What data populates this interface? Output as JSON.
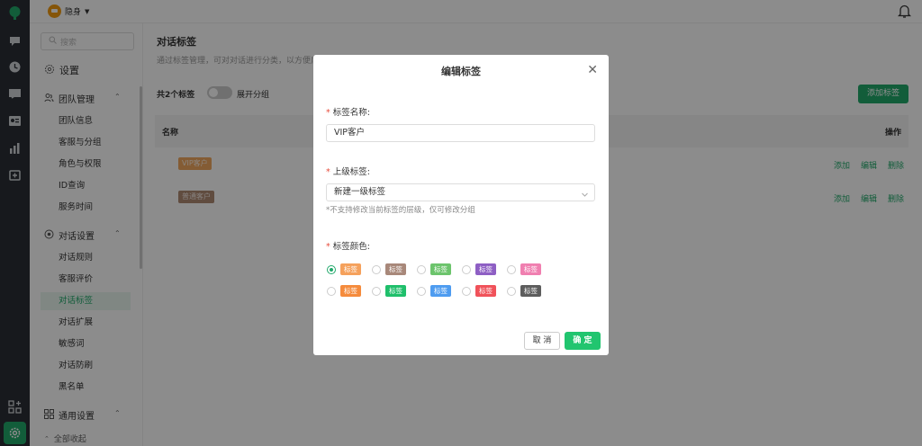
{
  "topbar": {
    "status": "隐身"
  },
  "sidebar": {
    "search_placeholder": "搜索",
    "settings_title": "设置",
    "groups": [
      {
        "label": "团队管理",
        "items": [
          "团队信息",
          "客服与分组",
          "角色与权限",
          "ID查询",
          "服务时间"
        ]
      },
      {
        "label": "对话设置",
        "items": [
          "对话规则",
          "客服评价",
          "对话标签",
          "对话扩展",
          "敏感词",
          "对话防刷",
          "黑名单"
        ]
      },
      {
        "label": "通用设置"
      }
    ],
    "collapse_all": "全部收起"
  },
  "main": {
    "title": "对话标签",
    "description": "通过标签管理，可对对话进行分类，以方便后",
    "count": "共2个标签",
    "expand_label": "展开分组",
    "add_button": "添加标签",
    "columns": {
      "name": "名称",
      "actions": "操作"
    },
    "rows": [
      {
        "tag": "VIP客户",
        "tag_color": "#f0a860",
        "tag_text_color": "#fff3e6"
      },
      {
        "tag": "普通客户",
        "tag_color": "#b08a74",
        "tag_text_color": "#f5ece6"
      }
    ],
    "row_actions": [
      "添加",
      "编辑",
      "删除"
    ]
  },
  "modal": {
    "title": "编辑标签",
    "name_label": "标签名称:",
    "name_value": "VIP客户",
    "parent_label": "上级标签:",
    "parent_value": "新建一级标签",
    "parent_hint": "*不支持修改当前标签的层级，仅可修改分组",
    "color_label": "标签颜色:",
    "chip_text": "标签",
    "colors": [
      {
        "hex": "#f5a15c",
        "selected": true
      },
      {
        "hex": "#a8887a",
        "selected": false
      },
      {
        "hex": "#6cc46c",
        "selected": false
      },
      {
        "hex": "#8e5fc4",
        "selected": false
      },
      {
        "hex": "#f07fb0",
        "selected": false
      },
      {
        "hex": "#f58b3c",
        "selected": false
      },
      {
        "hex": "#1fbf6b",
        "selected": false
      },
      {
        "hex": "#4e9cf0",
        "selected": false
      },
      {
        "hex": "#f0525a",
        "selected": false
      },
      {
        "hex": "#5d5d5d",
        "selected": false
      }
    ],
    "cancel": "取 消",
    "confirm": "确 定"
  },
  "accent_color": "#21a96b"
}
